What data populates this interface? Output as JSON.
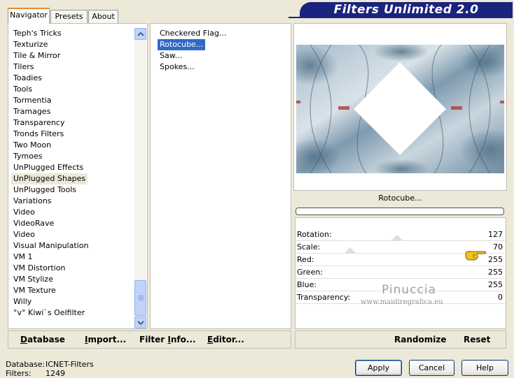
{
  "tabs": [
    {
      "label": "Navigator",
      "active": true
    },
    {
      "label": "Presets",
      "active": false
    },
    {
      "label": "About",
      "active": false
    }
  ],
  "title": "Filters Unlimited 2.0",
  "categories": [
    {
      "label": "Teph's Tricks"
    },
    {
      "label": "Texturize"
    },
    {
      "label": "Tile & Mirror"
    },
    {
      "label": "Tilers"
    },
    {
      "label": "Toadies"
    },
    {
      "label": "Tools"
    },
    {
      "label": "Tormentia"
    },
    {
      "label": "Tramages"
    },
    {
      "label": "Transparency"
    },
    {
      "label": "Tronds Filters"
    },
    {
      "label": "Two Moon"
    },
    {
      "label": "Tymoes"
    },
    {
      "label": "UnPlugged Effects"
    },
    {
      "label": "UnPlugged Shapes",
      "selected": true
    },
    {
      "label": "UnPlugged Tools"
    },
    {
      "label": "Variations"
    },
    {
      "label": "Video"
    },
    {
      "label": "VideoRave"
    },
    {
      "label": "Video"
    },
    {
      "label": "Visual Manipulation"
    },
    {
      "label": "VM 1"
    },
    {
      "label": "VM Distortion"
    },
    {
      "label": "VM Stylize"
    },
    {
      "label": "VM Texture"
    },
    {
      "label": "Willy"
    },
    {
      "label": "°v° Kiwi`s Oelfilter"
    }
  ],
  "filters": [
    {
      "label": "Checkered Flag..."
    },
    {
      "label": "Rotocube...",
      "selected": true
    },
    {
      "label": "Saw..."
    },
    {
      "label": "Spokes..."
    }
  ],
  "preview": {
    "filter_name": "Rotocube..."
  },
  "params": [
    {
      "label": "Rotation:",
      "value": "127",
      "slider": 0.5
    },
    {
      "label": "Scale:",
      "value": "70",
      "slider": 0.27
    },
    {
      "label": "Red:",
      "value": "255"
    },
    {
      "label": "Green:",
      "value": "255"
    },
    {
      "label": "Blue:",
      "value": "255"
    },
    {
      "label": "Transparency:",
      "value": "0"
    }
  ],
  "left_buttons": {
    "database": {
      "pre": "",
      "u": "D",
      "post": "atabase"
    },
    "import": {
      "pre": "",
      "u": "I",
      "post": "mport..."
    },
    "filter_info": {
      "pre": "Filter ",
      "u": "I",
      "post": "nfo..."
    },
    "editor": {
      "pre": "",
      "u": "E",
      "post": "ditor..."
    }
  },
  "right_buttons": {
    "randomize": "Randomize",
    "reset": "Reset"
  },
  "status": {
    "database_label": "Database:",
    "database_value": "ICNET-Filters",
    "filters_label": "Filters:",
    "filters_value": "1249"
  },
  "dialog_buttons": {
    "apply": "Apply",
    "cancel": "Cancel",
    "help": "Help"
  },
  "watermark": {
    "name": "Pinuccia",
    "url": "www.maidiregrafica.eu"
  },
  "colors": {
    "accent": "#1A237E",
    "selection": "#316AC5",
    "tab_highlight": "#E68B2C"
  }
}
